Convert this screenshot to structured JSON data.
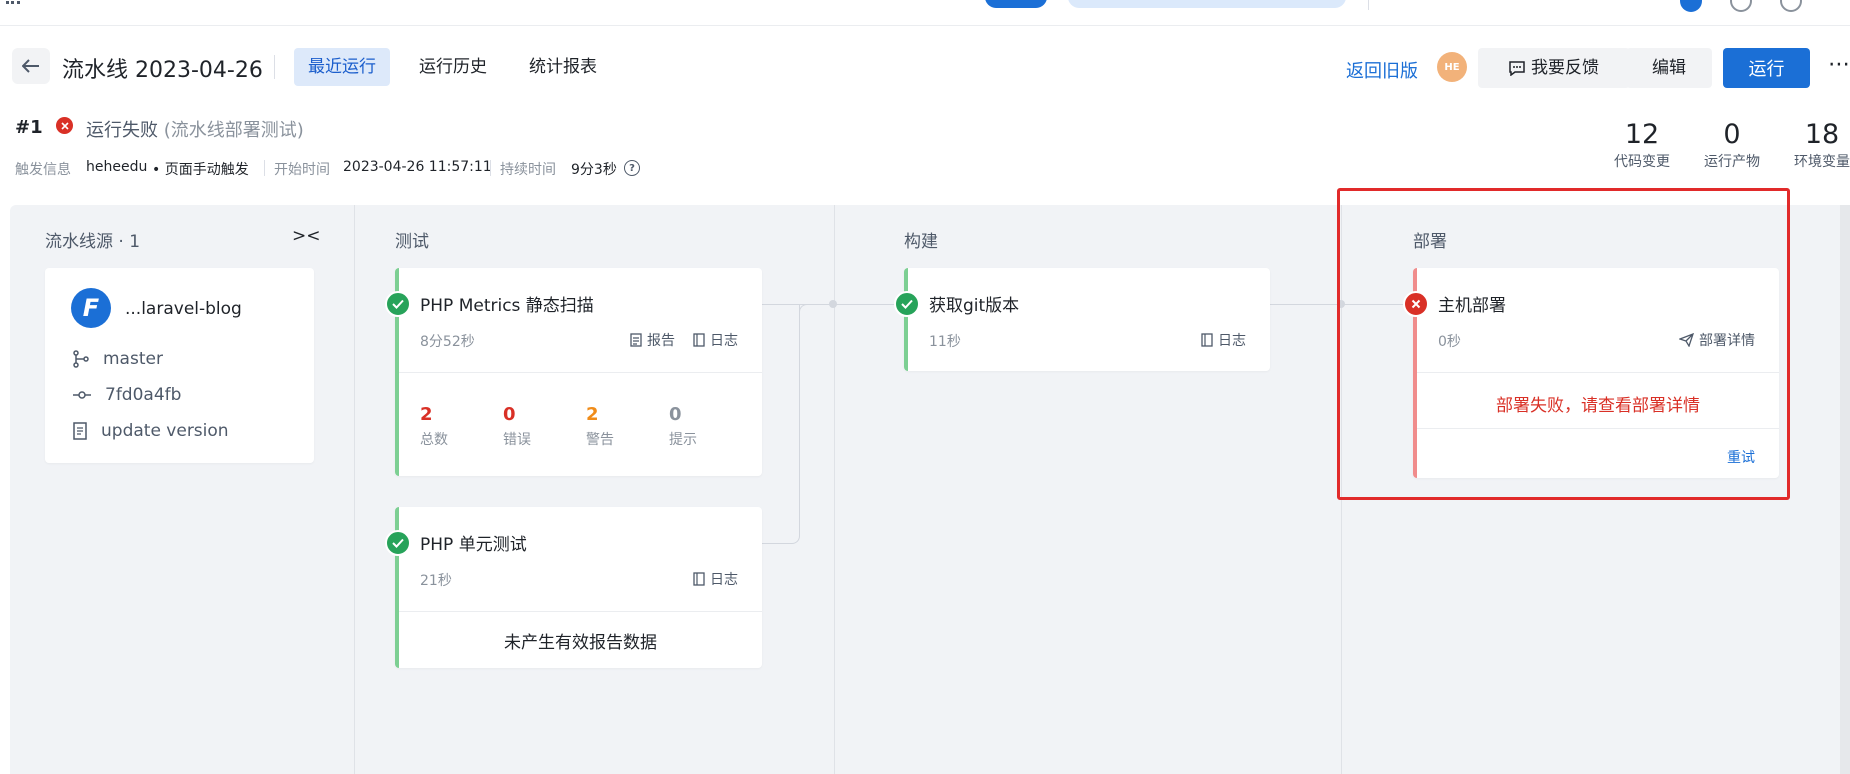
{
  "header": {
    "title": "流水线 2023-04-26",
    "tabs": [
      "最近运行",
      "运行历史",
      "统计报表"
    ],
    "return_old": "返回旧版",
    "avatar": "HE",
    "feedback": "我要反馈",
    "edit": "编辑",
    "run": "运行"
  },
  "run": {
    "id": "#1",
    "status": "运行失败",
    "desc": "(流水线部署测试)",
    "trigger_label": "触发信息",
    "trigger_user": "heheedu",
    "trigger_way": "• 页面手动触发",
    "start_label": "开始时间",
    "start_time": "2023-04-26 11:57:11",
    "duration_label": "持续时间",
    "duration": "9分3秒"
  },
  "stats": [
    {
      "num": "12",
      "label": "代码变更"
    },
    {
      "num": "0",
      "label": "运行产物"
    },
    {
      "num": "18",
      "label": "环境变量"
    }
  ],
  "columns": {
    "source": "流水线源 · 1",
    "test": "测试",
    "build": "构建",
    "deploy": "部署"
  },
  "source": {
    "logo": "F",
    "repo": "...laravel-blog",
    "branch": "master",
    "commit": "7fd0a4fb",
    "message": "update version"
  },
  "jobs": {
    "metrics": {
      "name": "PHP Metrics 静态扫描",
      "duration": "8分52秒",
      "report": "报告",
      "log": "日志",
      "counts": [
        {
          "value": "2",
          "label": "总数",
          "color": "#d93026"
        },
        {
          "value": "0",
          "label": "错误",
          "color": "#d93026"
        },
        {
          "value": "2",
          "label": "警告",
          "color": "#f08c1a"
        },
        {
          "value": "0",
          "label": "提示",
          "color": "#8a929c"
        }
      ]
    },
    "unit": {
      "name": "PHP 单元测试",
      "duration": "21秒",
      "log": "日志",
      "empty": "未产生有效报告数据"
    },
    "git": {
      "name": "获取git版本",
      "duration": "11秒",
      "log": "日志"
    },
    "deploy": {
      "name": "主机部署",
      "duration": "0秒",
      "detail": "部署详情",
      "error": "部署失败，请查看部署详情",
      "retry": "重试"
    }
  },
  "colors": {
    "primary": "#1b6fd6",
    "success": "#27a35a",
    "error": "#d93026",
    "highlight": "#e12a2a"
  }
}
